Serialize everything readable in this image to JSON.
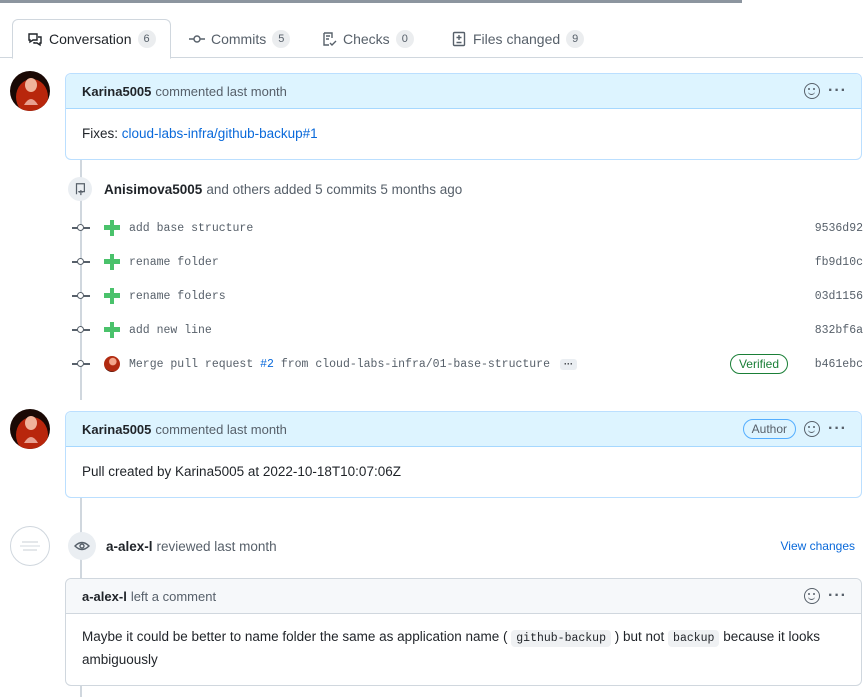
{
  "tabs": [
    {
      "label": "Conversation",
      "count": "6",
      "icon": "conversation-icon"
    },
    {
      "label": "Commits",
      "count": "5",
      "icon": "commit-icon"
    },
    {
      "label": "Checks",
      "count": "0",
      "icon": "checklist-icon"
    },
    {
      "label": "Files changed",
      "count": "9",
      "icon": "file-diff-icon"
    }
  ],
  "comment1": {
    "author": "Karina5005",
    "meta": "commented last month",
    "body_prefix": "Fixes: ",
    "body_link": "cloud-labs-infra/github-backup#1"
  },
  "commits_group": {
    "author": "Anisimova5005",
    "meta": "and others added 5 commits 5 months ago",
    "items": [
      {
        "message": "add base structure",
        "sha": "9536d92"
      },
      {
        "message": "rename folder",
        "sha": "fb9d10c"
      },
      {
        "message": "rename folders",
        "sha": "03d1156"
      },
      {
        "message": "add new line",
        "sha": "832bf6a"
      }
    ],
    "merge": {
      "prefix": "Merge pull request ",
      "pr_link": "#2",
      "suffix": " from cloud-labs-infra/01-base-structure",
      "ellipsis": "···",
      "verified": "Verified",
      "sha": "b461ebc"
    }
  },
  "comment2": {
    "author": "Karina5005",
    "meta": "commented last month",
    "badge": "Author",
    "body": "Pull created by Karina5005 at 2022-10-18T10:07:06Z"
  },
  "review": {
    "author": "a-alex-l",
    "meta": "reviewed last month",
    "view_changes": "View changes"
  },
  "review_comment": {
    "author": "a-alex-l",
    "meta": "left a comment",
    "body_1": "Maybe it could be better to name folder the same as application name (",
    "code_1": "github-backup",
    "body_2": ") but not",
    "code_2": "backup",
    "body_3": "because it looks ambiguously"
  },
  "actions": {
    "kebab": "···"
  }
}
